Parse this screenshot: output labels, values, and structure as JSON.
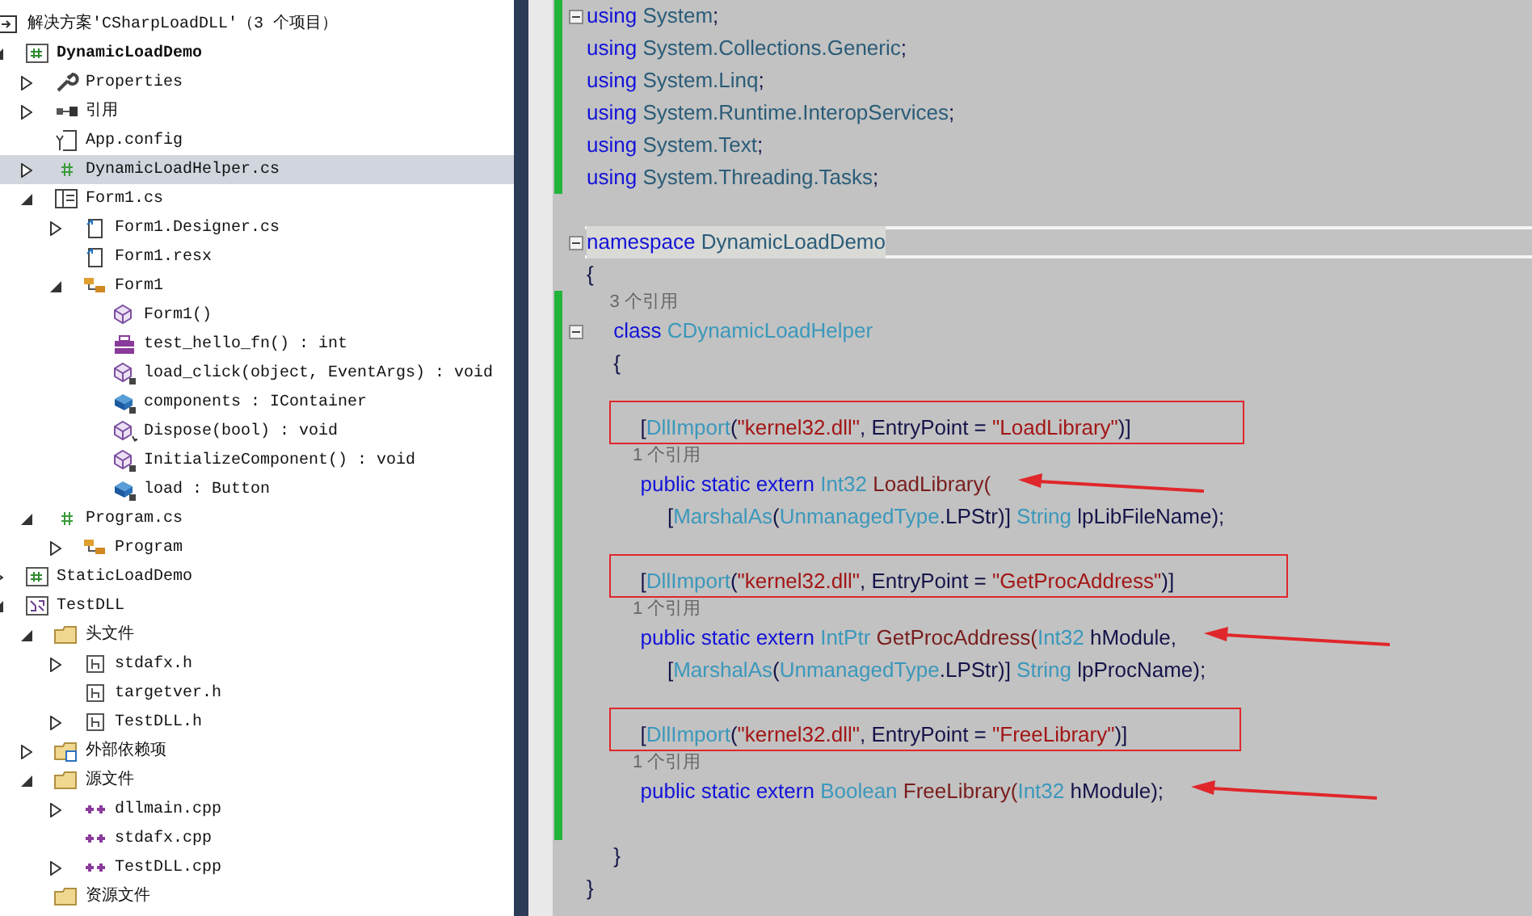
{
  "solution_explorer": {
    "items": [
      {
        "label": "解决方案'CSharpLoadDLL'（3 个项目）",
        "kind": "solution",
        "selected": false,
        "children": [
          {
            "label": "DynamicLoadDemo",
            "kind": "csproj",
            "bold": true,
            "expanded": true,
            "selected": false,
            "children": [
              {
                "label": "Properties",
                "kind": "wrench",
                "expanded": false,
                "selected": false
              },
              {
                "label": "引用",
                "kind": "references",
                "expanded": false,
                "selected": false
              },
              {
                "label": "App.config",
                "kind": "config",
                "selected": false
              },
              {
                "label": "DynamicLoadHelper.cs",
                "kind": "cs",
                "expanded": false,
                "selected": true
              },
              {
                "label": "Form1.cs",
                "kind": "form",
                "expanded": true,
                "selected": false,
                "children": [
                  {
                    "label": "Form1.Designer.cs",
                    "kind": "designer",
                    "expanded": false,
                    "selected": false
                  },
                  {
                    "label": "Form1.resx",
                    "kind": "designer",
                    "selected": false
                  },
                  {
                    "label": "Form1",
                    "kind": "class",
                    "expanded": true,
                    "selected": false,
                    "children": [
                      {
                        "label": "Form1()",
                        "kind": "method",
                        "selected": false
                      },
                      {
                        "label": "test_hello_fn() : int",
                        "kind": "toolbox",
                        "selected": false
                      },
                      {
                        "label": "load_click(object, EventArgs) : void",
                        "kind": "method-private",
                        "selected": false
                      },
                      {
                        "label": "components : IContainer",
                        "kind": "field-private",
                        "selected": false
                      },
                      {
                        "label": "Dispose(bool) : void",
                        "kind": "method-protected",
                        "selected": false
                      },
                      {
                        "label": "InitializeComponent() : void",
                        "kind": "method-private",
                        "selected": false
                      },
                      {
                        "label": "load : Button",
                        "kind": "field-private",
                        "selected": false
                      }
                    ]
                  }
                ]
              },
              {
                "label": "Program.cs",
                "kind": "cs",
                "expanded": true,
                "selected": false,
                "children": [
                  {
                    "label": "Program",
                    "kind": "class",
                    "expanded": false,
                    "selected": false
                  }
                ]
              }
            ]
          },
          {
            "label": "StaticLoadDemo",
            "kind": "csproj",
            "expanded": false,
            "selected": false
          },
          {
            "label": "TestDLL",
            "kind": "cppproj",
            "expanded": true,
            "selected": false,
            "children": [
              {
                "label": "头文件",
                "kind": "folder",
                "expanded": true,
                "selected": false,
                "children": [
                  {
                    "label": "stdafx.h",
                    "kind": "header",
                    "expanded": false,
                    "selected": false
                  },
                  {
                    "label": "targetver.h",
                    "kind": "header",
                    "selected": false
                  },
                  {
                    "label": "TestDLL.h",
                    "kind": "header",
                    "expanded": false,
                    "selected": false
                  }
                ]
              },
              {
                "label": "外部依赖项",
                "kind": "folder-external",
                "expanded": false,
                "selected": false
              },
              {
                "label": "源文件",
                "kind": "folder",
                "expanded": true,
                "selected": false,
                "children": [
                  {
                    "label": "dllmain.cpp",
                    "kind": "cpp",
                    "expanded": false,
                    "selected": false
                  },
                  {
                    "label": "stdafx.cpp",
                    "kind": "cpp",
                    "selected": false
                  },
                  {
                    "label": "TestDLL.cpp",
                    "kind": "cpp",
                    "expanded": false,
                    "selected": false
                  }
                ]
              },
              {
                "label": "资源文件",
                "kind": "folder",
                "selected": false
              }
            ]
          }
        ]
      }
    ]
  },
  "code_editor": {
    "lines": [
      {
        "kind": "code",
        "changed": true,
        "foldable": true,
        "current": false,
        "tokens": [
          {
            "kind": "keyword",
            "text": "using "
          },
          {
            "kind": "namespace",
            "text": "System"
          },
          {
            "kind": "plain",
            "text": ";"
          }
        ]
      },
      {
        "kind": "code",
        "changed": true,
        "current": false,
        "tokens": [
          {
            "kind": "keyword",
            "text": "using "
          },
          {
            "kind": "namespace",
            "text": "System.Collections.Generic"
          },
          {
            "kind": "plain",
            "text": ";"
          }
        ]
      },
      {
        "kind": "code",
        "changed": true,
        "current": false,
        "tokens": [
          {
            "kind": "keyword",
            "text": "using "
          },
          {
            "kind": "namespace",
            "text": "System.Linq"
          },
          {
            "kind": "plain",
            "text": ";"
          }
        ]
      },
      {
        "kind": "code",
        "changed": true,
        "current": false,
        "tokens": [
          {
            "kind": "keyword",
            "text": "using "
          },
          {
            "kind": "namespace",
            "text": "System.Runtime.InteropServices"
          },
          {
            "kind": "plain",
            "text": ";"
          }
        ]
      },
      {
        "kind": "code",
        "changed": true,
        "current": false,
        "tokens": [
          {
            "kind": "keyword",
            "text": "using "
          },
          {
            "kind": "namespace",
            "text": "System.Text"
          },
          {
            "kind": "plain",
            "text": ";"
          }
        ]
      },
      {
        "kind": "code",
        "changed": true,
        "current": false,
        "tokens": [
          {
            "kind": "keyword",
            "text": "using "
          },
          {
            "kind": "namespace",
            "text": "System.Threading.Tasks"
          },
          {
            "kind": "plain",
            "text": ";"
          }
        ]
      },
      {
        "kind": "blank"
      },
      {
        "kind": "code",
        "changed": false,
        "foldable": true,
        "current": true,
        "tokens": [
          {
            "kind": "keyword",
            "text": "namespace "
          },
          {
            "kind": "namespace",
            "text": "DynamicLoadDemo"
          }
        ]
      },
      {
        "kind": "code",
        "changed": false,
        "current": false,
        "tokens": [
          {
            "kind": "plain",
            "text": "{"
          }
        ]
      },
      {
        "kind": "lens",
        "changed": true,
        "text": "    3 个引用"
      },
      {
        "kind": "code",
        "changed": true,
        "foldable": true,
        "current": false,
        "tokens": [
          {
            "kind": "keyword",
            "text": "    class "
          },
          {
            "kind": "type",
            "text": "CDynamicLoadHelper"
          }
        ]
      },
      {
        "kind": "code",
        "changed": true,
        "current": false,
        "tokens": [
          {
            "kind": "plain",
            "text": "    {"
          }
        ]
      },
      {
        "kind": "blank",
        "changed": true
      },
      {
        "kind": "code",
        "changed": true,
        "current": false,
        "boxed": true,
        "tokens": [
          {
            "kind": "plain",
            "text": "        ["
          },
          {
            "kind": "type",
            "text": "DllImport"
          },
          {
            "kind": "plain",
            "text": "("
          },
          {
            "kind": "string",
            "text": "\"kernel32.dll\""
          },
          {
            "kind": "plain",
            "text": ", EntryPoint = "
          },
          {
            "kind": "string",
            "text": "\"LoadLibrary\""
          },
          {
            "kind": "plain",
            "text": ")]"
          }
        ]
      },
      {
        "kind": "lens",
        "changed": true,
        "text": "        1 个引用"
      },
      {
        "kind": "code",
        "changed": true,
        "current": false,
        "arrow": true,
        "tokens": [
          {
            "kind": "keyword",
            "text": "        public static extern "
          },
          {
            "kind": "type",
            "text": "Int32 "
          },
          {
            "kind": "method",
            "text": "LoadLibrary("
          }
        ]
      },
      {
        "kind": "code",
        "changed": true,
        "current": false,
        "tokens": [
          {
            "kind": "plain",
            "text": "            ["
          },
          {
            "kind": "type",
            "text": "MarshalAs"
          },
          {
            "kind": "plain",
            "text": "("
          },
          {
            "kind": "type",
            "text": "UnmanagedType"
          },
          {
            "kind": "plain",
            "text": ".LPStr)] "
          },
          {
            "kind": "type",
            "text": "String "
          },
          {
            "kind": "plain",
            "text": "lpLibFileName);"
          }
        ]
      },
      {
        "kind": "blank",
        "changed": true
      },
      {
        "kind": "code",
        "changed": true,
        "current": false,
        "boxed": true,
        "tokens": [
          {
            "kind": "plain",
            "text": "        ["
          },
          {
            "kind": "type",
            "text": "DllImport"
          },
          {
            "kind": "plain",
            "text": "("
          },
          {
            "kind": "string",
            "text": "\"kernel32.dll\""
          },
          {
            "kind": "plain",
            "text": ", EntryPoint = "
          },
          {
            "kind": "string",
            "text": "\"GetProcAddress\""
          },
          {
            "kind": "plain",
            "text": ")]"
          }
        ]
      },
      {
        "kind": "lens",
        "changed": true,
        "text": "        1 个引用"
      },
      {
        "kind": "code",
        "changed": true,
        "current": false,
        "arrow": true,
        "tokens": [
          {
            "kind": "keyword",
            "text": "        public static extern "
          },
          {
            "kind": "type",
            "text": "IntPtr "
          },
          {
            "kind": "method",
            "text": "GetProcAddress("
          },
          {
            "kind": "type",
            "text": "Int32 "
          },
          {
            "kind": "plain",
            "text": "hModule,"
          }
        ]
      },
      {
        "kind": "code",
        "changed": true,
        "current": false,
        "tokens": [
          {
            "kind": "plain",
            "text": "            ["
          },
          {
            "kind": "type",
            "text": "MarshalAs"
          },
          {
            "kind": "plain",
            "text": "("
          },
          {
            "kind": "type",
            "text": "UnmanagedType"
          },
          {
            "kind": "plain",
            "text": ".LPStr)] "
          },
          {
            "kind": "type",
            "text": "String "
          },
          {
            "kind": "plain",
            "text": "lpProcName);"
          }
        ]
      },
      {
        "kind": "blank",
        "changed": true
      },
      {
        "kind": "code",
        "changed": true,
        "current": false,
        "boxed": true,
        "tokens": [
          {
            "kind": "plain",
            "text": "        ["
          },
          {
            "kind": "type",
            "text": "DllImport"
          },
          {
            "kind": "plain",
            "text": "("
          },
          {
            "kind": "string",
            "text": "\"kernel32.dll\""
          },
          {
            "kind": "plain",
            "text": ", EntryPoint = "
          },
          {
            "kind": "string",
            "text": "\"FreeLibrary\""
          },
          {
            "kind": "plain",
            "text": ")]"
          }
        ]
      },
      {
        "kind": "lens",
        "changed": true,
        "text": "        1 个引用"
      },
      {
        "kind": "code",
        "changed": true,
        "current": false,
        "arrow": true,
        "tokens": [
          {
            "kind": "keyword",
            "text": "        public static extern "
          },
          {
            "kind": "type",
            "text": "Boolean "
          },
          {
            "kind": "method",
            "text": "FreeLibrary("
          },
          {
            "kind": "type",
            "text": "Int32 "
          },
          {
            "kind": "plain",
            "text": "hModule);"
          }
        ]
      },
      {
        "kind": "blank",
        "changed": true
      },
      {
        "kind": "code",
        "changed": false,
        "current": false,
        "tokens": [
          {
            "kind": "plain",
            "text": "    }"
          }
        ]
      },
      {
        "kind": "code",
        "changed": false,
        "current": false,
        "tokens": [
          {
            "kind": "plain",
            "text": "}"
          }
        ]
      }
    ]
  }
}
